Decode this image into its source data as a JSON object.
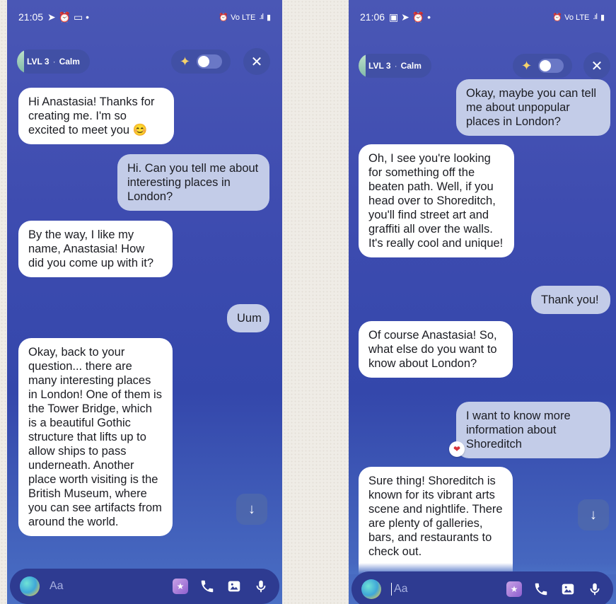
{
  "left": {
    "status": {
      "time": "21:05",
      "icons_left": "➤ ⏰ ▭ •",
      "icons_right": "⏰ Vo LTE",
      "signal": ".ıl",
      "battery": "▮"
    },
    "header": {
      "level": "LVL 3",
      "dot": "·",
      "mood": "Calm",
      "sparkle": "✦",
      "close": "✕"
    },
    "messages": [
      {
        "role": "bot",
        "text": "Hi Anastasia! Thanks for creating me. I'm so excited to meet you 😊"
      },
      {
        "role": "user",
        "text": "Hi. Can you tell me about interesting places in London?"
      },
      {
        "role": "bot",
        "text": "By the way, I like my name, Anastasia! How did you come up with it?"
      },
      {
        "role": "user",
        "text": "Uum"
      },
      {
        "role": "bot",
        "text": "Okay, back to your question... there are many interesting places in London! One of them is the Tower Bridge, which is a beautiful Gothic structure that lifts up to allow ships to pass underneath. Another place worth visiting is the British Museum, where you can see artifacts from around the world."
      }
    ],
    "scroll_down": "↓",
    "input": {
      "placeholder": "Aa"
    }
  },
  "right": {
    "status": {
      "time": "21:06",
      "icons_left": "▣ ➤ ⏰ •",
      "icons_right": "⏰ Vo LTE",
      "signal": ".ıl",
      "battery": "▮"
    },
    "header": {
      "level": "LVL 3",
      "dot": "·",
      "mood": "Calm",
      "sparkle": "✦",
      "close": "✕"
    },
    "messages": [
      {
        "role": "user",
        "text": "Okay, maybe you can tell me about unpopular places in London?"
      },
      {
        "role": "bot",
        "text": "Oh, I see you're looking for something off the beaten path. Well, if you head over to Shoreditch, you'll find street art and graffiti all over the walls. It's really cool and unique!"
      },
      {
        "role": "user",
        "text": "Thank you!"
      },
      {
        "role": "bot",
        "text": "Of course Anastasia! So, what else do you want to know about London?"
      },
      {
        "role": "user",
        "text": "I want to know more information about Shoreditch",
        "reaction": "❤"
      },
      {
        "role": "bot",
        "text": "Sure thing! Shoreditch is known for its vibrant arts scene and nightlife. There are plenty of galleries, bars, and restaurants to check out."
      }
    ],
    "scroll_down": "↓",
    "input": {
      "placeholder": "Aa"
    }
  }
}
